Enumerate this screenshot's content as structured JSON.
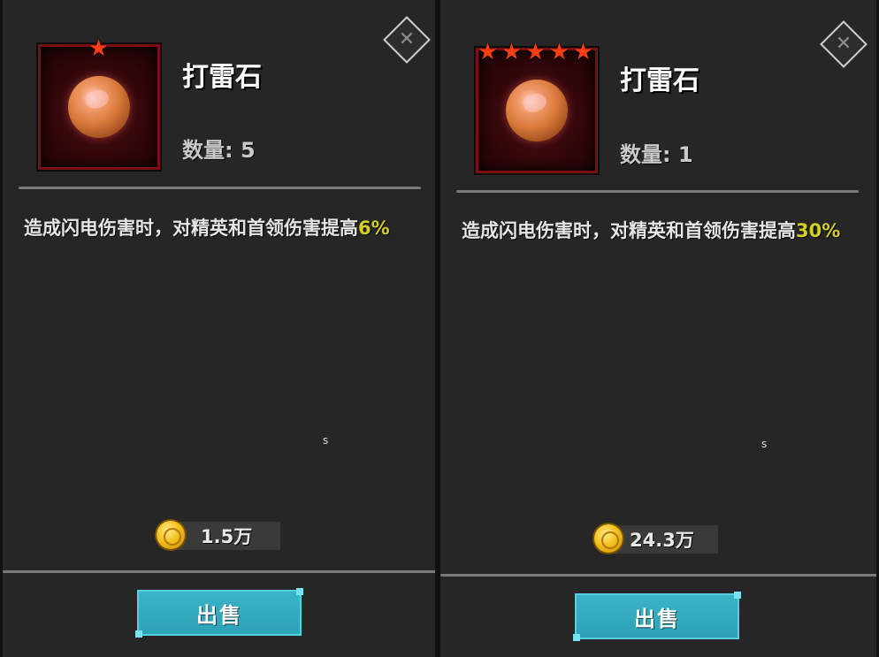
{
  "panels": [
    {
      "item_name": "打雷石",
      "stars": 1,
      "quantity_label": "数量:",
      "quantity_value": "5",
      "description_text": "造成闪电伤害时，对精英和首领伤害提高",
      "description_highlight": "6%",
      "tiny_label": "s",
      "price": "1.5万",
      "sell_label": "出售",
      "close_icon": "close-x-icon"
    },
    {
      "item_name": "打雷石",
      "stars": 5,
      "quantity_label": "数量:",
      "quantity_value": "1",
      "description_text": "造成闪电伤害时，对精英和首领伤害提高",
      "description_highlight": "30%",
      "tiny_label": "s",
      "price": "24.3万",
      "sell_label": "出售",
      "close_icon": "close-x-icon"
    }
  ],
  "colors": {
    "highlight": "#d4d01f",
    "star": "#ff3d14",
    "sell_button": "#3cb4c8",
    "coin": "#f3c11f",
    "icon_border": "#7a0e12"
  }
}
